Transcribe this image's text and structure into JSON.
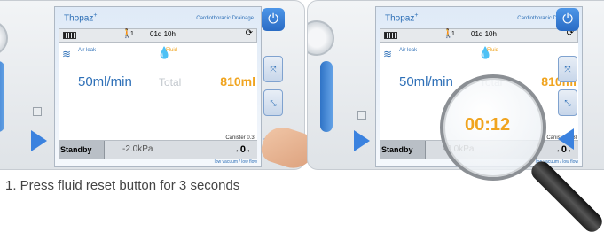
{
  "app": {
    "title": "Thopaz",
    "title_sup": "+",
    "subtitle": "Cardiothoracic Drainage"
  },
  "status": {
    "patient_count": "1",
    "time": "01d 10h"
  },
  "air": {
    "label": "Air leak",
    "value": "50ml/min"
  },
  "fluid": {
    "label": "Fluid",
    "total_label": "Total",
    "value": "810ml"
  },
  "bottom": {
    "mode": "Standby",
    "pressure": "-2.0kPa",
    "canister": "Canister 0.3l",
    "hint": "low vacuum / low flow"
  },
  "timer": {
    "value": "00:12"
  },
  "caption": "1. Press fluid reset button for 3 seconds",
  "colors": {
    "accent": "#2d6fb7",
    "fluid": "#f0a41f",
    "button_blue": "#3b82df"
  }
}
